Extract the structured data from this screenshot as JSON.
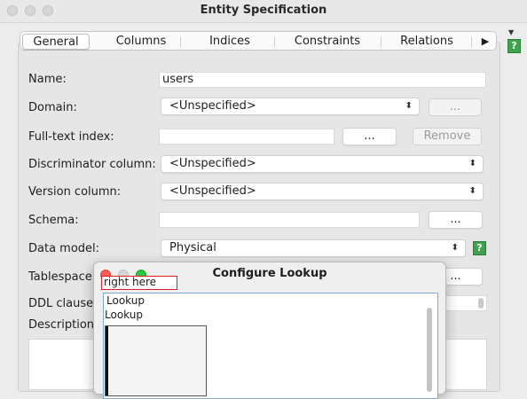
{
  "window": {
    "title": "Entity Specification"
  },
  "tabs": [
    "General",
    "Columns",
    "Indices",
    "Constraints",
    "Relations"
  ],
  "tab_more": "▶",
  "form": {
    "name_label": "Name:",
    "name_value": "users",
    "domain_label": "Domain:",
    "domain_value": "<Unspecified>",
    "domain_button": "...",
    "fulltext_label": "Full-text index:",
    "fulltext_value": "",
    "fulltext_button": "...",
    "remove_button": "Remove",
    "discriminator_label": "Discriminator column:",
    "discriminator_value": "<Unspecified>",
    "version_label": "Version column:",
    "version_value": "<Unspecified>",
    "schema_label": "Schema:",
    "schema_value": "",
    "schema_button": "...",
    "datamodel_label": "Data model:",
    "datamodel_value": "Physical",
    "tablespace_label": "Tablespace:",
    "tablespace_button": "...",
    "ddl_label": "DDL clause:",
    "description_label": "Description"
  },
  "help_icon": "?",
  "dialog": {
    "title": "Configure Lookup",
    "search_value": "right here",
    "items": [
      "Lookup",
      "Lookup"
    ]
  }
}
